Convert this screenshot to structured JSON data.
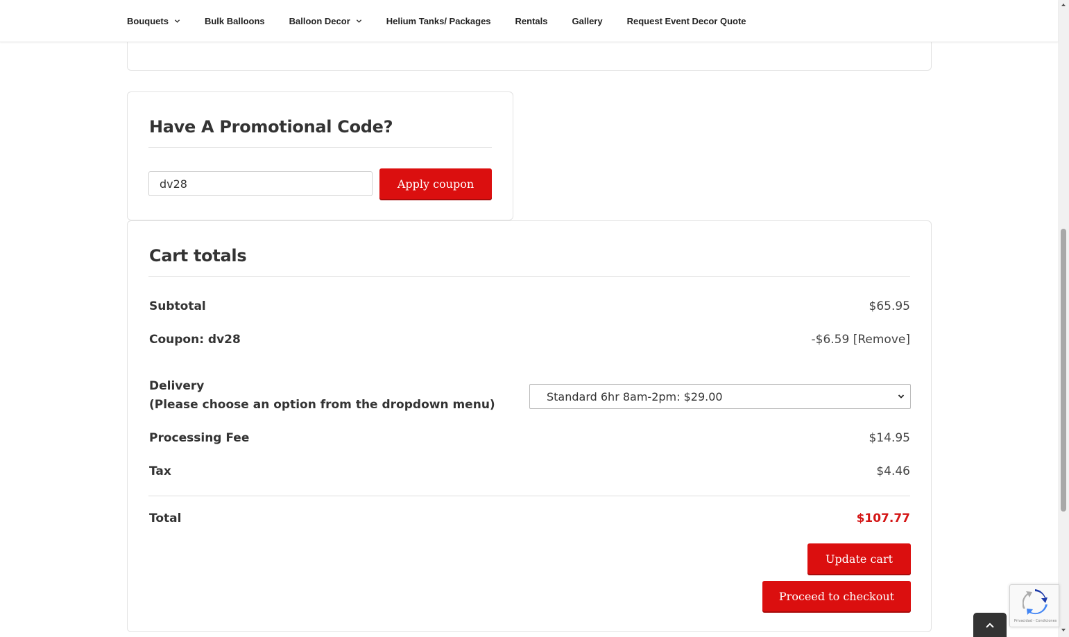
{
  "nav": {
    "items": [
      {
        "label": "Bouquets",
        "has_dropdown": true
      },
      {
        "label": "Bulk Balloons",
        "has_dropdown": false
      },
      {
        "label": "Balloon Decor",
        "has_dropdown": true
      },
      {
        "label": "Helium Tanks/ Packages",
        "has_dropdown": false
      },
      {
        "label": "Rentals",
        "has_dropdown": false
      },
      {
        "label": "Gallery",
        "has_dropdown": false
      },
      {
        "label": "Request Event Decor Quote",
        "has_dropdown": false
      }
    ]
  },
  "promo": {
    "title": "Have A Promotional Code?",
    "coupon_value": "dv28",
    "apply_label": "Apply coupon"
  },
  "cart_totals": {
    "title": "Cart totals",
    "subtotal_label": "Subtotal",
    "subtotal_value": "$65.95",
    "coupon_label": "Coupon: dv28",
    "coupon_value": "-$6.59",
    "coupon_remove": "[Remove]",
    "delivery_label": "Delivery",
    "delivery_hint": "(Please choose an option from the dropdown menu)",
    "delivery_selected": "Standard 6hr 8am-2pm: $29.00",
    "processing_label": "Processing Fee",
    "processing_value": "$14.95",
    "tax_label": "Tax",
    "tax_value": "$4.46",
    "total_label": "Total",
    "total_value": "$107.77",
    "update_label": "Update cart",
    "checkout_label": "Proceed to checkout"
  },
  "recaptcha": {
    "text": "Privacidad - Condiciones"
  },
  "colors": {
    "accent": "#db0f0f",
    "total": "#d41515"
  }
}
